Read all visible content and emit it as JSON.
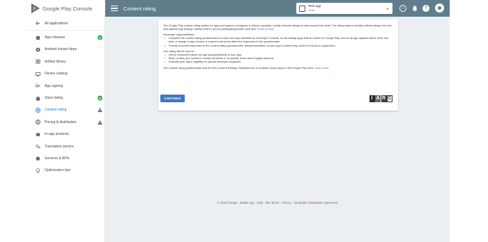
{
  "app": {
    "logo_text": "Google Play Console"
  },
  "header": {
    "title": "Content rating",
    "app_selector": {
      "name": "Test App",
      "status": "Draft"
    }
  },
  "sidebar": {
    "items": [
      {
        "label": "All applications",
        "icon": "arrow-left-icon",
        "status": ""
      },
      {
        "label": "App releases",
        "icon": "rocket-icon",
        "status": "check"
      },
      {
        "label": "Android Instant Apps",
        "icon": "bolt-icon",
        "status": ""
      },
      {
        "label": "Artifact library",
        "icon": "library-icon",
        "status": ""
      },
      {
        "label": "Device catalog",
        "icon": "device-icon",
        "status": ""
      },
      {
        "label": "App signing",
        "icon": "key-icon",
        "status": ""
      },
      {
        "label": "Store listing",
        "icon": "shopping-bag-icon",
        "status": "check"
      },
      {
        "label": "Content rating",
        "icon": "content-rating-icon",
        "status": "warning",
        "active": true
      },
      {
        "label": "Pricing & distribution",
        "icon": "globe-icon",
        "status": "warning"
      },
      {
        "label": "In-app products",
        "icon": "cart-icon",
        "status": ""
      },
      {
        "label": "Translation service",
        "icon": "translate-icon",
        "status": ""
      },
      {
        "label": "Services & APIs",
        "icon": "puzzle-icon",
        "status": ""
      },
      {
        "label": "Optimization tips",
        "icon": "lightbulb-icon",
        "status": ""
      }
    ]
  },
  "content": {
    "intro_pre": "The Google Play content rating system for apps and games is designed to deliver reputable, locally relevant ratings to users around the world. The rating system includes official ratings from the International Age Rating Coalition (IARC) and its participating bodies (see their ",
    "intro_link": "Terms of Use",
    "intro_post": ").",
    "responsibilities_heading": "Developer responsibilities:",
    "responsibilities": [
      "Complete the content rating questionnaire for each new app submitted to Developer Console, for all existing apps that are active on Google Play, and for all app updates where there has been a change to app content or features that would affect the responses to the questionnaire.",
      "Provide accurate responses to the content rating questionnaire. Misrepresentation of your app's content may result in removal or suspension."
    ],
    "usage_heading": "Your rating will be used to:",
    "usage": [
      "Inform consumers about the age appropriateness of your app.",
      "Block or filter your content in certain territories or to specific users where legally required.",
      "Evaluate your app's eligibility for special developer programs."
    ],
    "conditions_text": "The content rating questionnaire and the new Content Ratings Guidelines are a condition of your apps in the Google Play store.",
    "learn_more": "Learn more",
    "continue_label": "CONTINUE",
    "iarc_letters": [
      "I",
      "A",
      "R",
      "C"
    ]
  },
  "footer": {
    "copyright": "© 2018 Google",
    "links": [
      "Mobile App",
      "Help",
      "Site Terms",
      "Privacy",
      "Developer Distribution Agreement"
    ]
  },
  "colors": {
    "topbar": "#607d8b",
    "accent": "#1a73e8",
    "check": "#34a853",
    "warning": "#5f6368",
    "background": "#eceff1"
  }
}
